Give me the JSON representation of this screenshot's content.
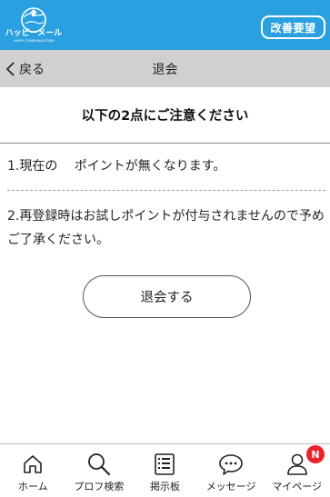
{
  "header": {
    "logo_text": "ハッピーメール",
    "logo_subtext": "HAPPY COMMUNICATION",
    "improve_label": "改善要望",
    "brand_color": "#2aa0e0"
  },
  "subheader": {
    "back_label": "戻る",
    "title": "退会"
  },
  "notice": {
    "heading": "以下の2点にご注意ください",
    "items": [
      "1.現在の　 ポイントが無くなります。",
      "2.再登録時はお試しポイントが付与されませんので予めご了承ください。"
    ]
  },
  "withdraw_button": {
    "label": "退会する"
  },
  "bottom_nav": {
    "items": [
      {
        "label": "ホーム",
        "icon": "home-icon"
      },
      {
        "label": "プロフ検索",
        "icon": "search-icon"
      },
      {
        "label": "掲示板",
        "icon": "board-icon"
      },
      {
        "label": "メッセージ",
        "icon": "message-icon"
      },
      {
        "label": "マイページ",
        "icon": "user-icon",
        "badge": "N"
      }
    ]
  },
  "colors": {
    "badge": "#e8232b",
    "subheader_bg": "#d0d0d0"
  }
}
